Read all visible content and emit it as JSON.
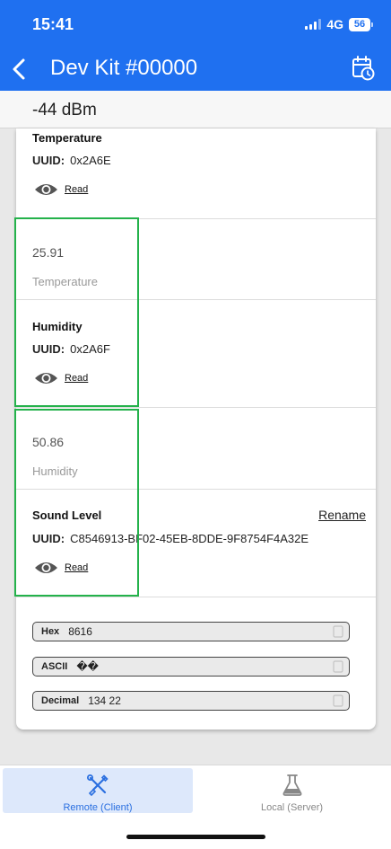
{
  "status": {
    "time": "15:41",
    "network": "4G",
    "battery": "56"
  },
  "header": {
    "title": "Dev Kit #00000",
    "back_icon": "chevron-left-icon",
    "action_icon": "calendar-clock-icon"
  },
  "rssi": "-44 dBm",
  "characteristics": [
    {
      "name": "Temperature",
      "uuid_label": "UUID:",
      "uuid": "0x2A6E",
      "read_label": "Read",
      "value": "25.91",
      "value_label": "Temperature"
    },
    {
      "name": "Humidity",
      "uuid_label": "UUID:",
      "uuid": "0x2A6F",
      "read_label": "Read",
      "value": "50.86",
      "value_label": "Humidity"
    },
    {
      "name": "Sound Level",
      "uuid_label": "UUID:",
      "uuid": "C8546913-BF02-45EB-8DDE-9F8754F4A32E",
      "read_label": "Read",
      "rename_label": "Rename"
    }
  ],
  "formats": [
    {
      "label": "Hex",
      "value": "8616"
    },
    {
      "label": "ASCII",
      "value": "��"
    },
    {
      "label": "Decimal",
      "value": "134 22"
    }
  ],
  "tabs": [
    {
      "label": "Remote (Client)",
      "icon": "tools-icon",
      "active": true
    },
    {
      "label": "Local (Server)",
      "icon": "flask-icon",
      "active": false
    }
  ],
  "colors": {
    "header": "#1f70f0",
    "highlight": "#24b24b",
    "active_tab_bg": "#dde8fb",
    "active_tab_text": "#2a6fe0"
  }
}
